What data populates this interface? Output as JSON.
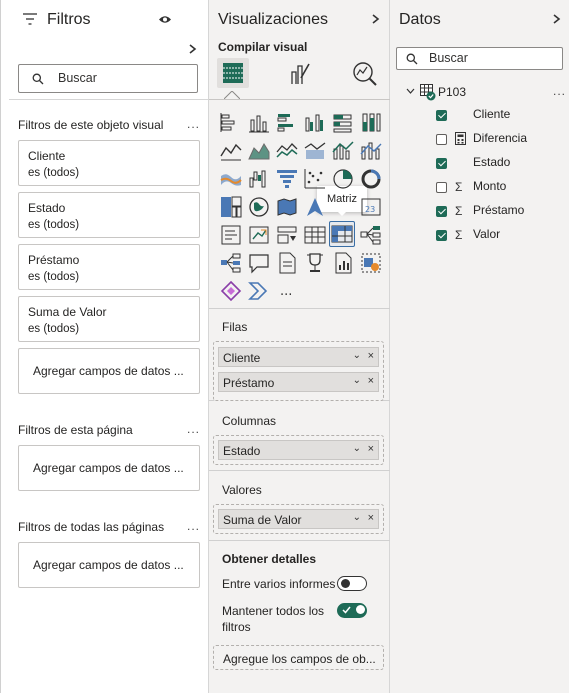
{
  "filters": {
    "title": "Filtros",
    "search_placeholder": "Buscar",
    "visual_section": "Filtros de este objeto visual",
    "cards": [
      {
        "field": "Cliente",
        "state": "es (todos)"
      },
      {
        "field": "Estado",
        "state": "es (todos)"
      },
      {
        "field": "Préstamo",
        "state": "es (todos)"
      },
      {
        "field": "Suma de Valor",
        "state": "es (todos)"
      }
    ],
    "add_fields": "Agregar campos de datos ...",
    "page_section": "Filtros de esta página",
    "all_pages_section": "Filtros de todas las páginas",
    "more": "..."
  },
  "viz": {
    "title": "Visualizaciones",
    "build_label": "Compilar visual",
    "tooltip": "Matriz",
    "more_visuals": "...",
    "wells": {
      "rows_label": "Filas",
      "rows": [
        "Cliente",
        "Préstamo"
      ],
      "columns_label": "Columnas",
      "columns": [
        "Estado"
      ],
      "values_label": "Valores",
      "values": [
        "Suma de Valor"
      ]
    },
    "drill": {
      "title": "Obtener detalles",
      "cross_report": "Entre varios informes",
      "cross_report_on": false,
      "keep_filters_1": "Mantener todos los",
      "keep_filters_2": "filtros",
      "keep_filters_on": true,
      "add_fields": "Agregue los campos de ob..."
    }
  },
  "data": {
    "title": "Datos",
    "search_placeholder": "Buscar",
    "table": "P103",
    "more": "...",
    "fields": [
      {
        "name": "Cliente",
        "checked": true,
        "icon": "none"
      },
      {
        "name": "Diferencia",
        "checked": false,
        "icon": "calculator-icon"
      },
      {
        "name": "Estado",
        "checked": true,
        "icon": "none"
      },
      {
        "name": "Monto",
        "checked": false,
        "icon": "sigma-icon"
      },
      {
        "name": "Préstamo",
        "checked": true,
        "icon": "sigma-icon"
      },
      {
        "name": "Valor",
        "checked": true,
        "icon": "sigma-icon"
      }
    ]
  },
  "colors": {
    "accent": "#1e6b57",
    "selected_border": "#3a6ea5"
  }
}
